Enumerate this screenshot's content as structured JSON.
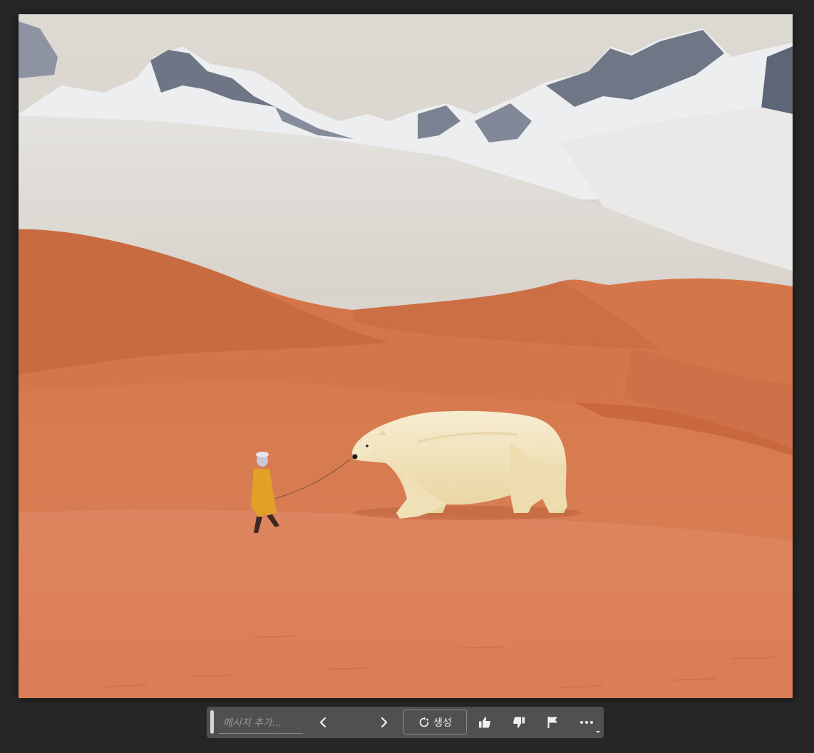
{
  "taskbar": {
    "prompt_placeholder": "메시지 추가...",
    "generate_label": "생성",
    "icons": [
      "previous-icon",
      "next-icon",
      "regenerate-icon",
      "thumbs-up-icon",
      "thumbs-down-icon",
      "flag-icon",
      "more-icon"
    ]
  },
  "colors": {
    "workspace_bg": "#262626",
    "taskbar_bg": "#505050",
    "sand": "#d77b52",
    "sky": "#d9d4cd"
  }
}
